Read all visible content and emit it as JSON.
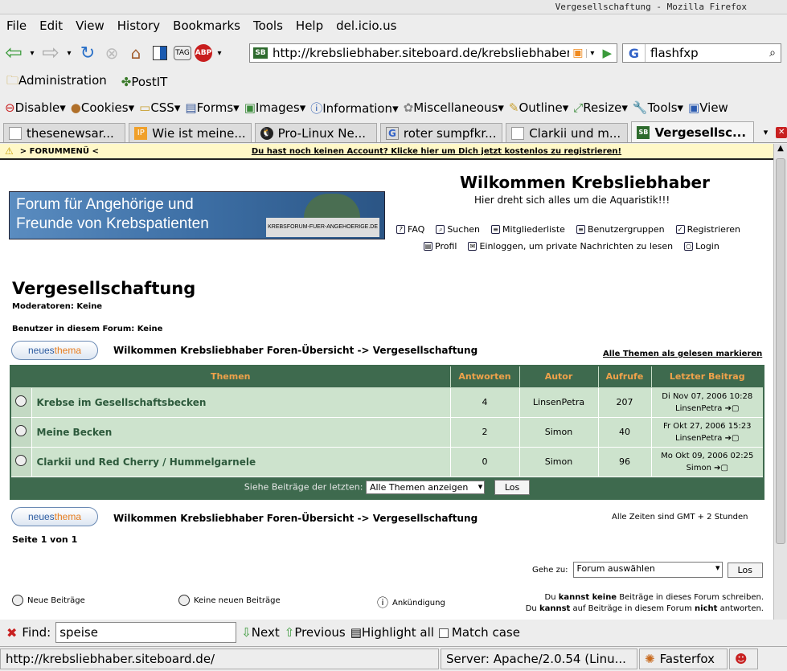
{
  "window_title": "Vergesellschaftung - Mozilla Firefox",
  "menu": [
    "File",
    "Edit",
    "View",
    "History",
    "Bookmarks",
    "Tools",
    "Help",
    "del.icio.us"
  ],
  "url": "http://krebsliebhaber.siteboard.de/krebsliebhaber-",
  "search_value": "flashfxp",
  "bookmarks": [
    "Administration",
    "PostIT"
  ],
  "devbar": [
    "Disable",
    "Cookies",
    "CSS",
    "Forms",
    "Images",
    "Information",
    "Miscellaneous",
    "Outline",
    "Resize",
    "Tools",
    "View"
  ],
  "tabs": [
    {
      "label": "thesenewsar...",
      "icon": "doc-icon"
    },
    {
      "label": "Wie ist meine...",
      "icon": "ip-icon"
    },
    {
      "label": "Pro-Linux Ne...",
      "icon": "tux-icon"
    },
    {
      "label": "roter sumpfkr...",
      "icon": "google-icon"
    },
    {
      "label": "Clarkii und m...",
      "icon": "doc-icon"
    },
    {
      "label": "Vergesellsc...",
      "icon": "sb-icon"
    }
  ],
  "forum": {
    "top_menu": "> FORUMMENÜ <",
    "register_notice": "Du hast noch keinen Account? Klicke hier um Dich jetzt kostenlos zu registrieren!",
    "welcome": "Wilkommen Krebsliebhaber",
    "subtitle": "Hier dreht sich alles um die Aquaristik!!!",
    "banner_line1": "Forum für Angehörige und",
    "banner_line2": "Freunde von Krebspatienten",
    "banner_small": "KREBSFORUM-FUER-ANGEHOERIGE.DE",
    "links_row1": [
      "FAQ",
      "Suchen",
      "Mitgliederliste",
      "Benutzergruppen",
      "Registrieren"
    ],
    "links_row2": [
      "Profil",
      "Einloggen, um private Nachrichten zu lesen",
      "Login"
    ],
    "title": "Vergesellschaftung",
    "moderators": "Moderatoren: Keine",
    "users": "Benutzer in diesem Forum: Keine",
    "new_topic_a": "neues",
    "new_topic_b": "thema",
    "breadcrumb": "Wilkommen Krebsliebhaber Foren-Übersicht -> Vergesellschaftung",
    "mark_all": "Alle Themen als gelesen markieren",
    "headers": [
      "Themen",
      "Antworten",
      "Autor",
      "Aufrufe",
      "Letzter Beitrag"
    ],
    "topics": [
      {
        "title": "Krebse im Gesellschaftsbecken",
        "replies": "4",
        "author": "LinsenPetra",
        "views": "207",
        "last_date": "Di Nov 07, 2006 10:28",
        "last_user": "LinsenPetra"
      },
      {
        "title": "Meine Becken",
        "replies": "2",
        "author": "Simon",
        "views": "40",
        "last_date": "Fr Okt 27, 2006 15:23",
        "last_user": "LinsenPetra"
      },
      {
        "title": "Clarkii und Red Cherry / Hummelgarnele",
        "replies": "0",
        "author": "Simon",
        "views": "96",
        "last_date": "Mo Okt 09, 2006 02:25",
        "last_user": "Simon"
      }
    ],
    "filter_label": "Siehe Beiträge der letzten:",
    "filter_value": "Alle Themen anzeigen",
    "go": "Los",
    "timezone": "Alle Zeiten sind GMT + 2 Stunden",
    "page": "Seite 1 von 1",
    "jump_label": "Gehe zu:",
    "jump_value": "Forum auswählen",
    "legend": [
      "Neue Beiträge",
      "Keine neuen Beiträge",
      "Ankündigung"
    ],
    "perm1_a": "Du ",
    "perm1_b": "kannst keine",
    "perm1_c": " Beiträge in dieses Forum schreiben.",
    "perm2_a": "Du ",
    "perm2_b": "kannst",
    "perm2_c": " auf Beiträge in diesem Forum ",
    "perm2_d": "nicht",
    "perm2_e": " antworten."
  },
  "find": {
    "label": "Find:",
    "value": "speise",
    "next": "Next",
    "previous": "Previous",
    "highlight": "Highlight all",
    "match": "Match case"
  },
  "status": {
    "url": "http://krebsliebhaber.siteboard.de/",
    "server": "Server: Apache/2.0.54 (Linu...",
    "ext": "Fasterfox"
  }
}
